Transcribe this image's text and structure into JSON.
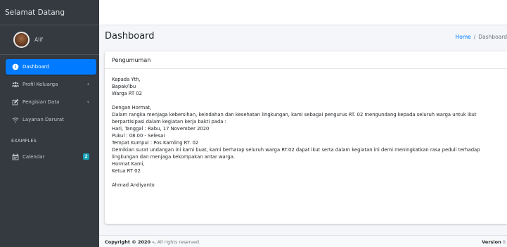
{
  "brand": {
    "title": "Selamat Datang"
  },
  "user": {
    "name": "Alif"
  },
  "sidebar": {
    "items": [
      {
        "label": "Dashboard",
        "icon": "dashboard-icon"
      },
      {
        "label": "Profil Keluarga",
        "icon": "users-icon"
      },
      {
        "label": "Pengisian Data",
        "icon": "edit-icon"
      },
      {
        "label": "Layanan Darurat",
        "icon": "wifi-icon"
      }
    ],
    "header": "EXAMPLES",
    "calendar": {
      "label": "Calendar",
      "badge": "2",
      "icon": "calendar-icon"
    },
    "accent_color": "#007bff"
  },
  "content": {
    "title": "Dashboard",
    "breadcrumb": {
      "home": "Home",
      "separator": "/",
      "current": "Dashboard"
    }
  },
  "card": {
    "header": "Pengumuman",
    "lines": {
      "l1": "Kepada Yth,",
      "l2": "Bapak/Ibu",
      "l3": "Warga RT 02",
      "l4": "Dengan Hormat,",
      "l5": "Dalam rangka menjaga kebersihan, keindahan dan kesehatan lingkungan, kami sebagai pengurus RT. 02 mengundang kepada seluruh warga untuk ikut",
      "l6": "berpartisipasi dalam kegiatan kerja bakti pada :",
      "l7": "Hari, Tanggal : Rabu, 17 November 2020",
      "l8": "Pukul : 08.00 - Selesai",
      "l9": "Tempat Kumpul : Pos Kamling RT. 02",
      "l10": "Demikian surat undangan ini kami buat, kami berharap seluruh warga RT.02 dapat ikut serta dalam kegiatan ini demi meningkatkan rasa peduli terhadap",
      "l11": "lingkungan dan menjaga kekompakan antar warga.",
      "l12": "Hormat Kami,",
      "l13": "Ketua RT 02",
      "l14": "Ahmad Andiyanto"
    }
  },
  "footer": {
    "copyright_bold": "Copyright © 2020 -.",
    "copyright_rest": " All rights reserved.",
    "version_label": "Version",
    "version_value": "0."
  }
}
